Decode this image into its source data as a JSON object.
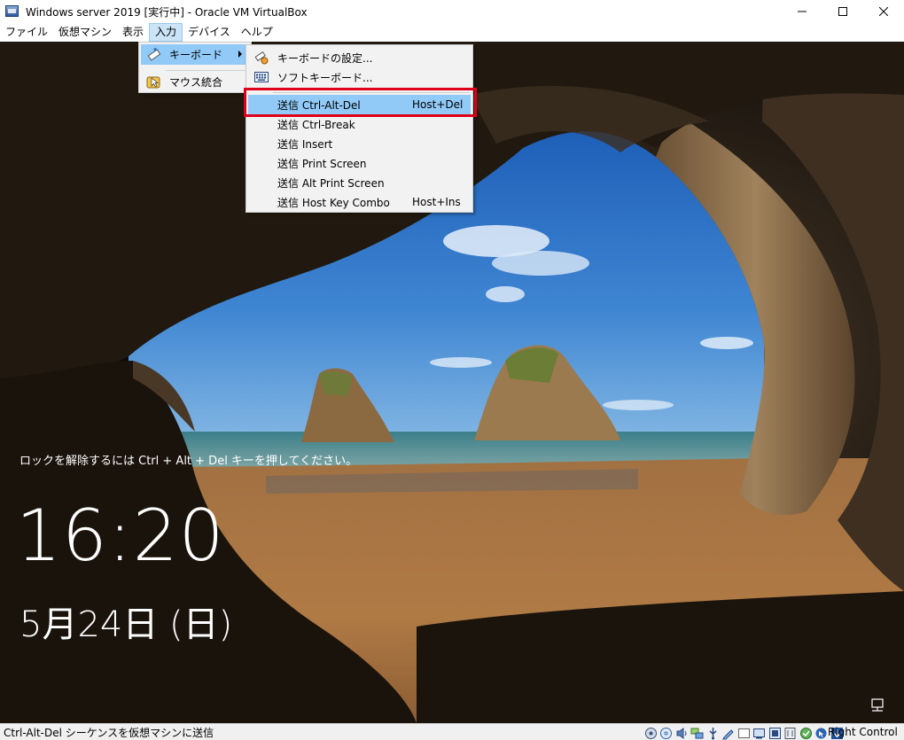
{
  "window": {
    "title": "Windows server 2019 [実行中] - Oracle VM VirtualBox"
  },
  "menubar": [
    {
      "label": "ファイル"
    },
    {
      "label": "仮想マシン"
    },
    {
      "label": "表示"
    },
    {
      "label": "入力",
      "active": true
    },
    {
      "label": "デバイス"
    },
    {
      "label": "ヘルプ"
    }
  ],
  "input_menu": {
    "items": [
      {
        "label": "キーボード",
        "icon": "keyboard-pen-icon",
        "submenu": true,
        "highlighted": true
      },
      {
        "label": "マウス統合",
        "icon": "mouse-integration-icon"
      }
    ]
  },
  "keyboard_submenu": {
    "items": [
      {
        "label": "キーボードの設定...",
        "icon": "keyboard-settings-icon"
      },
      {
        "label": "ソフトキーボード...",
        "icon": "soft-keyboard-icon"
      },
      {
        "label": "送信 Ctrl-Alt-Del",
        "shortcut": "Host+Del",
        "highlighted": true
      },
      {
        "label": "送信 Ctrl-Break"
      },
      {
        "label": "送信 Insert"
      },
      {
        "label": "送信 Print Screen"
      },
      {
        "label": "送信 Alt Print Screen"
      },
      {
        "label": "送信 Host Key Combo",
        "shortcut": "Host+Ins"
      }
    ]
  },
  "lockscreen": {
    "message": "ロックを解除するには Ctrl + Alt + Del キーを押してください。",
    "time": "16:20",
    "date": "5月24日 (日)"
  },
  "statusbar": {
    "text": "Ctrl-Alt-Del シーケンスを仮想マシンに送信",
    "host_key": "Right Control",
    "icons": [
      "hard-disk-icon",
      "optical-drive-icon",
      "audio-icon",
      "network-icon",
      "usb-icon",
      "shared-folders-icon",
      "display-icon",
      "video-capture-icon",
      "cpu-icon",
      "recording-icon",
      "vm-activity-icon",
      "mouse-integration-icon",
      "keyboard-capture-icon"
    ]
  }
}
